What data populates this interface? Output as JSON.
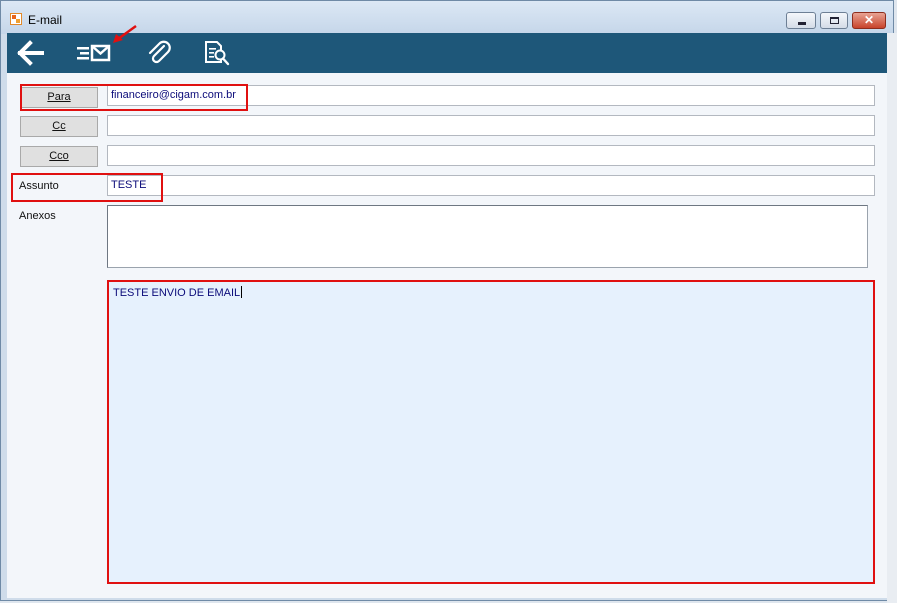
{
  "window": {
    "title": "E-mail",
    "controls": {
      "minimize": "minimize",
      "maximize": "maximize",
      "close": "close"
    }
  },
  "toolbar": {
    "icons": [
      "arrow-left-icon",
      "send-email-icon",
      "paperclip-icon",
      "search-document-icon"
    ]
  },
  "form": {
    "to": {
      "label": "Para",
      "value": "financeiro@cigam.com.br"
    },
    "cc": {
      "label": "Cc",
      "value": ""
    },
    "bcc": {
      "label": "Cco",
      "value": ""
    },
    "subject": {
      "label": "Assunto",
      "value": "TESTE"
    },
    "attachments": {
      "label": "Anexos"
    },
    "body": "TESTE ENVIO DE EMAIL"
  },
  "colors": {
    "toolbar_bg": "#1e5779",
    "highlight": "#e01010",
    "body_bg": "#e6f1fd",
    "text_blue": "#0b0b7a"
  }
}
